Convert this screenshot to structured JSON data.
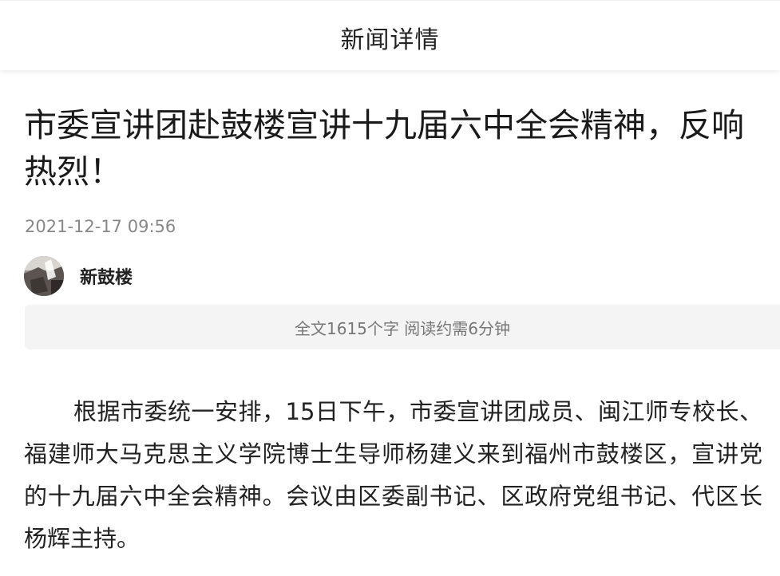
{
  "header": {
    "title": "新闻详情"
  },
  "article": {
    "title": "市委宣讲团赴鼓楼宣讲十九届六中全会精神，反响热烈！",
    "date": "2021-12-17 09:56",
    "author": "新鼓楼",
    "read_info": "全文1615个字 阅读约需6分钟",
    "paragraph_1": "根据市委统一安排，15日下午，市委宣讲团成员、闽江师专校长、福建师大马克思主义学院博士生导师杨建义来到福州市鼓楼区，宣讲党的十九届六中全会精神。会议由区委副书记、区政府党组书记、代区长杨辉主持。"
  }
}
